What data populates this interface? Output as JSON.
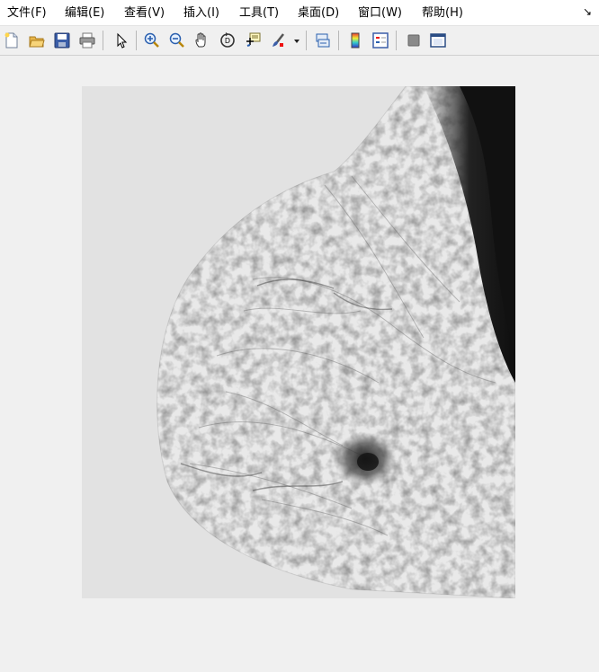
{
  "menubar": {
    "items": [
      {
        "id": "file",
        "label": "文件(F)"
      },
      {
        "id": "edit",
        "label": "编辑(E)"
      },
      {
        "id": "view",
        "label": "查看(V)"
      },
      {
        "id": "insert",
        "label": "插入(I)"
      },
      {
        "id": "tools",
        "label": "工具(T)"
      },
      {
        "id": "desktop",
        "label": "桌面(D)"
      },
      {
        "id": "window",
        "label": "窗口(W)"
      },
      {
        "id": "help",
        "label": "帮助(H)"
      }
    ],
    "dock_icon": "dock-arrow-icon"
  },
  "toolbar": {
    "buttons": [
      {
        "id": "new-figure",
        "icon": "new-file-icon"
      },
      {
        "id": "open-file",
        "icon": "open-folder-icon"
      },
      {
        "id": "save-figure",
        "icon": "save-disk-icon"
      },
      {
        "id": "print-figure",
        "icon": "printer-icon"
      },
      {
        "id": "edit-plot",
        "icon": "pointer-arrow-icon"
      },
      {
        "id": "zoom-in",
        "icon": "zoom-in-icon"
      },
      {
        "id": "zoom-out",
        "icon": "zoom-out-icon"
      },
      {
        "id": "pan",
        "icon": "hand-pan-icon"
      },
      {
        "id": "rotate-3d",
        "icon": "rotate-3d-icon"
      },
      {
        "id": "data-cursor",
        "icon": "data-cursor-icon"
      },
      {
        "id": "brush",
        "icon": "brush-icon"
      },
      {
        "id": "link-plot",
        "icon": "link-plot-icon"
      },
      {
        "id": "insert-colorbar",
        "icon": "colorbar-icon"
      },
      {
        "id": "insert-legend",
        "icon": "legend-icon"
      },
      {
        "id": "hide-plot-tools",
        "icon": "hide-plot-tools-icon"
      },
      {
        "id": "show-plot-tools",
        "icon": "show-plot-tools-icon"
      }
    ]
  },
  "figure": {
    "background": "#f0f0f0",
    "image_description_colors": {
      "tissue": "#e6e6e6",
      "background": "#e2e2e2",
      "dense": "#111111"
    }
  }
}
